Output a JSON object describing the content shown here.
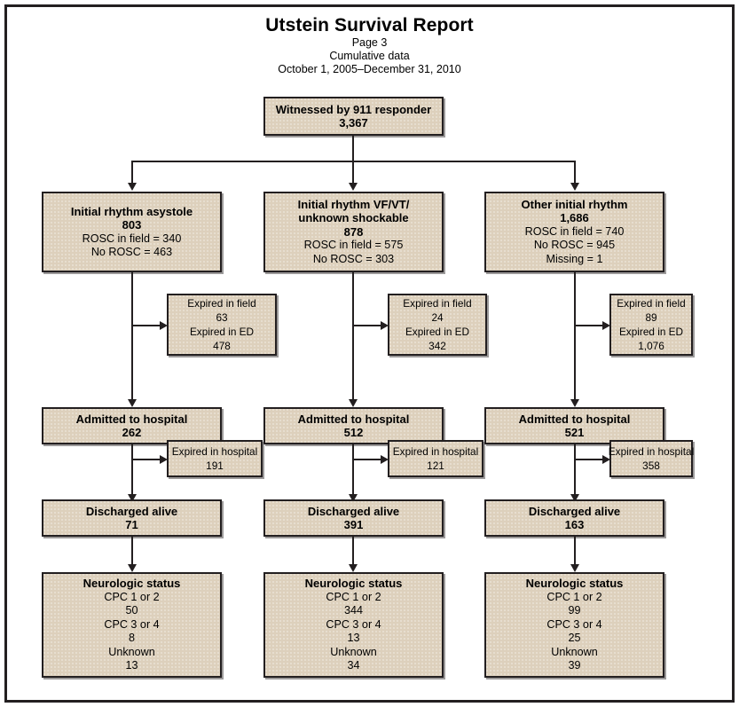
{
  "header": {
    "title": "Utstein Survival Report",
    "page": "Page 3",
    "data_kind": "Cumulative data",
    "date_range": "October 1, 2005–December 31, 2010"
  },
  "flowchart": {
    "root": {
      "label": "Witnessed by 911 responder",
      "value": "3,367"
    },
    "columns": [
      {
        "rhythm": {
          "label_line1": "Initial rhythm asystole",
          "label_line2": "",
          "value": "803",
          "detail1": "ROSC in field = 340",
          "detail2": "No ROSC = 463",
          "detail3": ""
        },
        "expired_prehospital": {
          "label1": "Expired in field",
          "value1": "63",
          "label2": "Expired in ED",
          "value2": "478"
        },
        "admitted": {
          "label": "Admitted to hospital",
          "value": "262"
        },
        "expired_hospital": {
          "label": "Expired in hospital",
          "value": "191"
        },
        "discharged": {
          "label": "Discharged alive",
          "value": "71"
        },
        "neuro": {
          "label": "Neurologic status",
          "cpc12_label": "CPC 1 or 2",
          "cpc12_value": "50",
          "cpc34_label": "CPC 3 or 4",
          "cpc34_value": "8",
          "unknown_label": "Unknown",
          "unknown_value": "13"
        }
      },
      {
        "rhythm": {
          "label_line1": "Initial rhythm VF/VT/",
          "label_line2": "unknown shockable",
          "value": "878",
          "detail1": "ROSC in field = 575",
          "detail2": "No ROSC = 303",
          "detail3": ""
        },
        "expired_prehospital": {
          "label1": "Expired in field",
          "value1": "24",
          "label2": "Expired in ED",
          "value2": "342"
        },
        "admitted": {
          "label": "Admitted to hospital",
          "value": "512"
        },
        "expired_hospital": {
          "label": "Expired in hospital",
          "value": "121"
        },
        "discharged": {
          "label": "Discharged alive",
          "value": "391"
        },
        "neuro": {
          "label": "Neurologic status",
          "cpc12_label": "CPC 1 or 2",
          "cpc12_value": "344",
          "cpc34_label": "CPC 3 or 4",
          "cpc34_value": "13",
          "unknown_label": "Unknown",
          "unknown_value": "34"
        }
      },
      {
        "rhythm": {
          "label_line1": "Other initial rhythm",
          "label_line2": "",
          "value": "1,686",
          "detail1": "ROSC in field = 740",
          "detail2": "No ROSC = 945",
          "detail3": "Missing = 1"
        },
        "expired_prehospital": {
          "label1": "Expired in field",
          "value1": "89",
          "label2": "Expired in ED",
          "value2": "1,076"
        },
        "admitted": {
          "label": "Admitted to hospital",
          "value": "521"
        },
        "expired_hospital": {
          "label": "Expired in hospital",
          "value": "358"
        },
        "discharged": {
          "label": "Discharged alive",
          "value": "163"
        },
        "neuro": {
          "label": "Neurologic status",
          "cpc12_label": "CPC 1 or 2",
          "cpc12_value": "99",
          "cpc34_label": "CPC 3 or 4",
          "cpc34_value": "25",
          "unknown_label": "Unknown",
          "unknown_value": "39"
        }
      }
    ]
  },
  "colors": {
    "box_fill": "#ddd0bc",
    "line": "#231f20",
    "page_background": "#ffffff"
  }
}
